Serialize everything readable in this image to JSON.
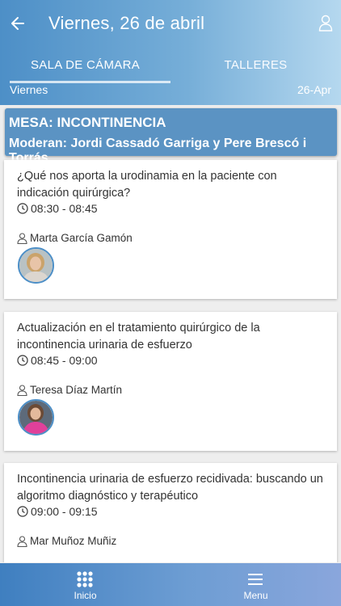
{
  "header": {
    "title": "Viernes, 26 de abril",
    "tabs": [
      {
        "label": "SALA DE CÁMARA",
        "active": true
      },
      {
        "label": "TALLERES",
        "active": false
      }
    ],
    "day_label": "Viernes",
    "date_short": "26-Apr"
  },
  "session": {
    "title": "MESA: INCONTINENCIA",
    "moderators": "Moderan: Jordi Cassadó Garriga y Pere Brescó i Torrás"
  },
  "talks": [
    {
      "title": "¿Qué nos aporta la urodinamia en la paciente con indicación quirúrgica?",
      "time": "08:30 - 08:45",
      "speaker": "Marta García Gamón"
    },
    {
      "title": "Actualización en el tratamiento quirúrgico de la incontinencia urinaria de esfuerzo",
      "time": "08:45 - 09:00",
      "speaker": "Teresa Díaz Martín"
    },
    {
      "title": "Incontinencia urinaria de esfuerzo recidivada: buscando un algoritmo diagnóstico y terapéutico",
      "time": "09:00 - 09:15",
      "speaker": "Mar Muñoz Muñiz"
    }
  ],
  "bottom_nav": [
    {
      "label": "Inicio",
      "icon": "grid-icon"
    },
    {
      "label": "Menu",
      "icon": "hamburger-icon"
    }
  ],
  "colors": {
    "header_start": "#4d8fc7",
    "header_end": "#b5d8ef",
    "session_bg": "#5b93c3",
    "avatar_ring": "#4d8fc7"
  }
}
